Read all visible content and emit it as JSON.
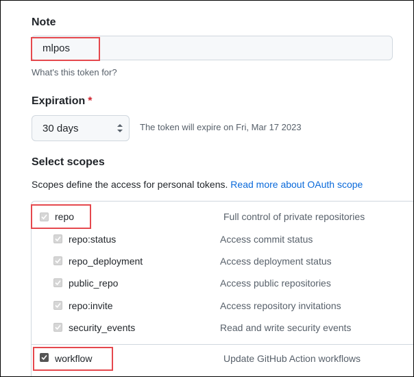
{
  "note": {
    "label": "Note",
    "value": "mlpos",
    "hint": "What's this token for?"
  },
  "expiration": {
    "label": "Expiration",
    "required_mark": "*",
    "selected": "30 days",
    "info": "The token will expire on Fri, Mar 17 2023"
  },
  "scopes": {
    "title": "Select scopes",
    "description": "Scopes define the access for personal tokens.",
    "link": "Read more about OAuth scope",
    "items": [
      {
        "name": "repo",
        "desc": "Full control of private repositories"
      },
      {
        "name": "repo:status",
        "desc": "Access commit status"
      },
      {
        "name": "repo_deployment",
        "desc": "Access deployment status"
      },
      {
        "name": "public_repo",
        "desc": "Access public repositories"
      },
      {
        "name": "repo:invite",
        "desc": "Access repository invitations"
      },
      {
        "name": "security_events",
        "desc": "Read and write security events"
      },
      {
        "name": "workflow",
        "desc": "Update GitHub Action workflows"
      }
    ]
  },
  "colors": {
    "highlight": "#e5484d",
    "link": "#0969da",
    "required": "#cf222e"
  }
}
